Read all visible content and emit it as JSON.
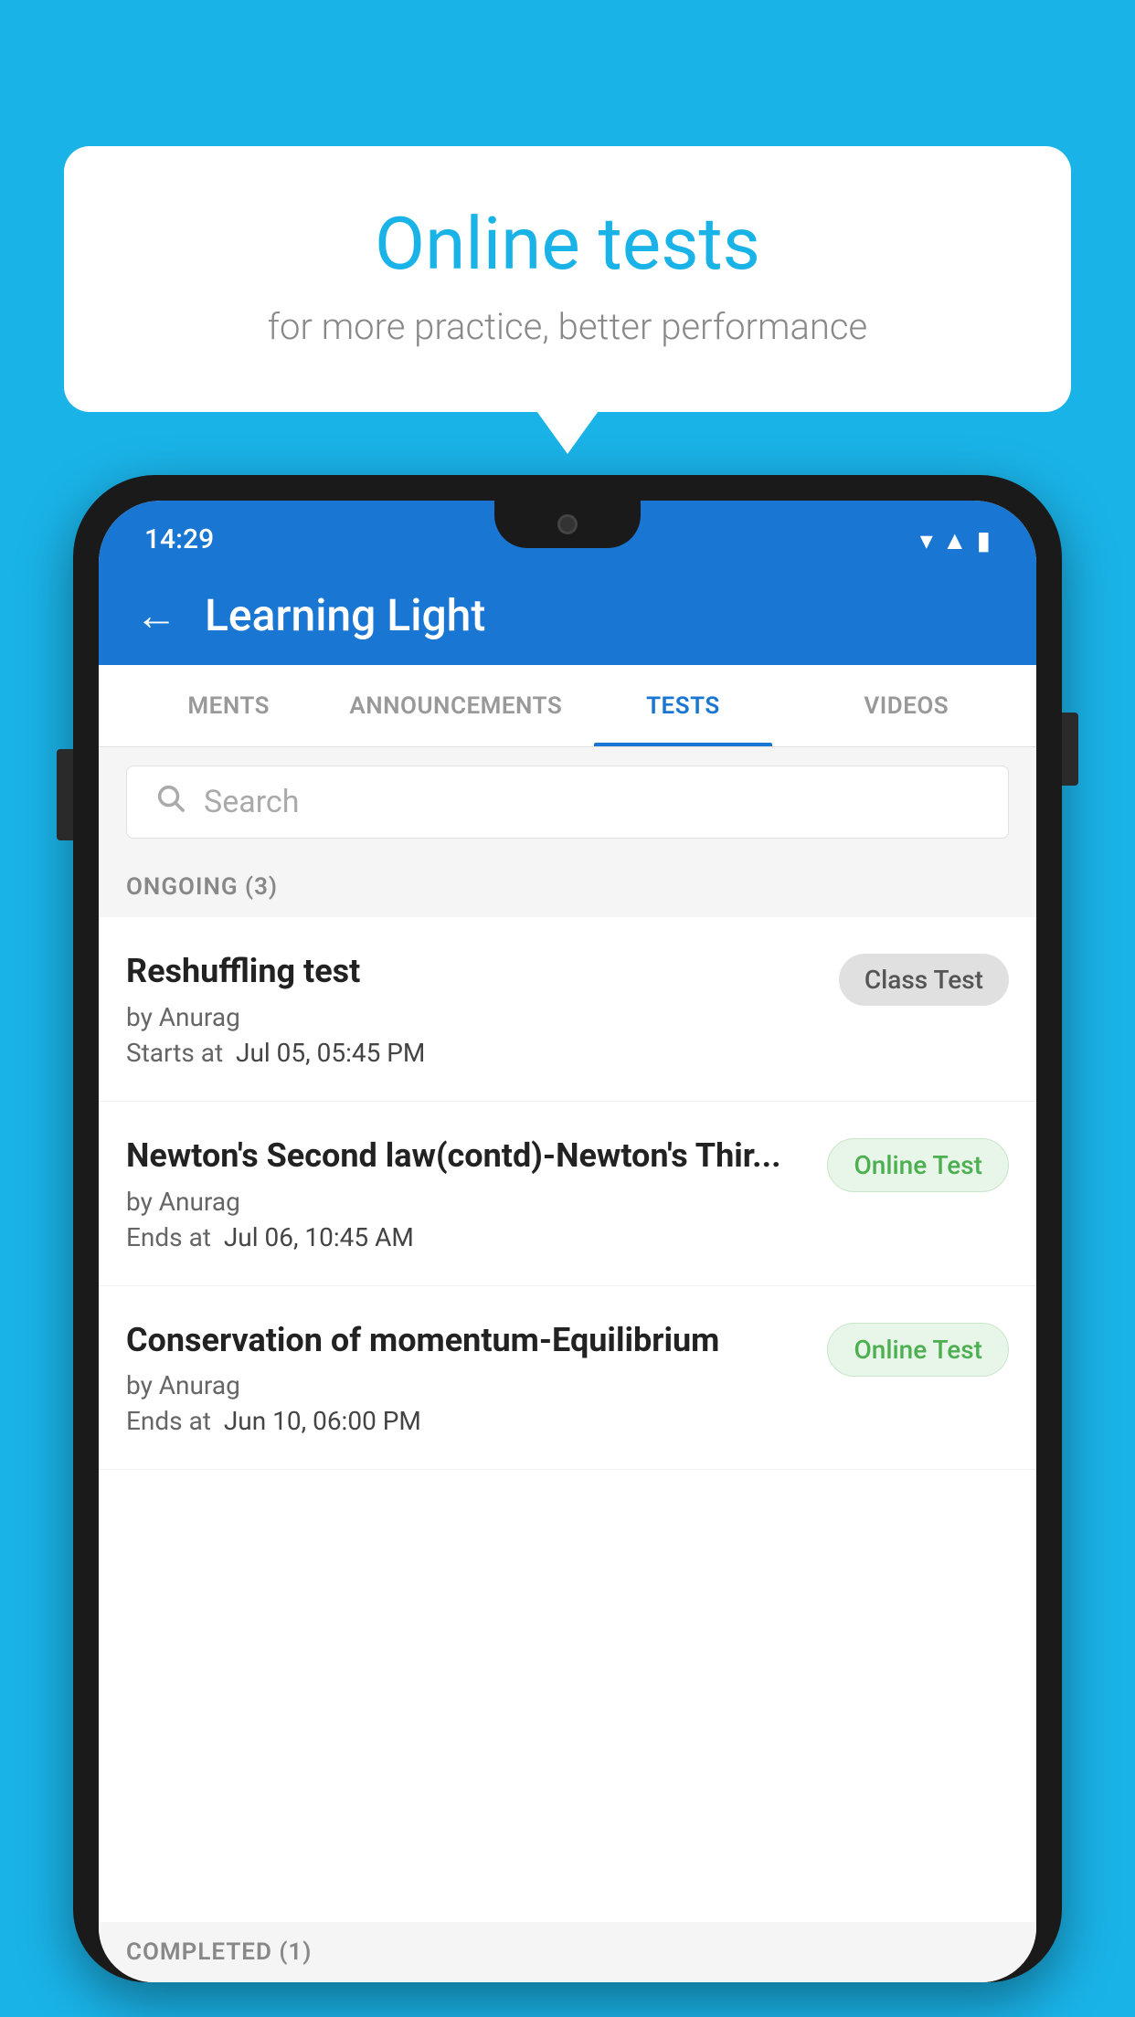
{
  "background": {
    "color": "#1ab3e8"
  },
  "speech_bubble": {
    "title": "Online tests",
    "subtitle": "for more practice, better performance"
  },
  "phone": {
    "status_bar": {
      "time": "14:29",
      "icons": [
        "wifi",
        "signal",
        "battery"
      ]
    },
    "app_bar": {
      "back_label": "←",
      "title": "Learning Light"
    },
    "tabs": [
      {
        "label": "MENTS",
        "active": false
      },
      {
        "label": "ANNOUNCEMENTS",
        "active": false
      },
      {
        "label": "TESTS",
        "active": true
      },
      {
        "label": "VIDEOS",
        "active": false
      }
    ],
    "search": {
      "placeholder": "Search"
    },
    "sections": [
      {
        "label": "ONGOING (3)",
        "items": [
          {
            "name": "Reshuffling test",
            "author": "by Anurag",
            "time_label": "Starts at",
            "time_value": "Jul 05, 05:45 PM",
            "badge": "Class Test",
            "badge_type": "class"
          },
          {
            "name": "Newton's Second law(contd)-Newton's Thir...",
            "author": "by Anurag",
            "time_label": "Ends at",
            "time_value": "Jul 06, 10:45 AM",
            "badge": "Online Test",
            "badge_type": "online"
          },
          {
            "name": "Conservation of momentum-Equilibrium",
            "author": "by Anurag",
            "time_label": "Ends at",
            "time_value": "Jun 10, 06:00 PM",
            "badge": "Online Test",
            "badge_type": "online"
          }
        ]
      },
      {
        "label": "COMPLETED (1)",
        "items": []
      }
    ]
  }
}
